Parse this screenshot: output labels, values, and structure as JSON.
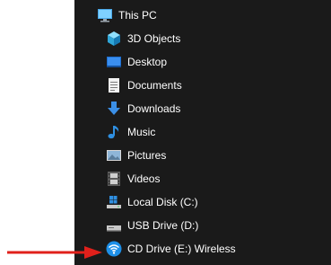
{
  "tree": {
    "root": {
      "label": "This PC",
      "icon": "monitor-icon"
    },
    "items": [
      {
        "label": "3D Objects",
        "icon": "cube-icon"
      },
      {
        "label": "Desktop",
        "icon": "desktop-folder-icon"
      },
      {
        "label": "Documents",
        "icon": "document-icon"
      },
      {
        "label": "Downloads",
        "icon": "download-arrow-icon"
      },
      {
        "label": "Music",
        "icon": "music-note-icon"
      },
      {
        "label": "Pictures",
        "icon": "picture-icon"
      },
      {
        "label": "Videos",
        "icon": "film-icon"
      },
      {
        "label": "Local Disk (C:)",
        "icon": "windows-drive-icon"
      },
      {
        "label": "USB Drive (D:)",
        "icon": "drive-icon"
      },
      {
        "label": "CD Drive (E:) Wireless",
        "icon": "wireless-icon"
      }
    ]
  },
  "annotation": {
    "icon": "red-arrow-icon",
    "color": "#e0201b"
  }
}
